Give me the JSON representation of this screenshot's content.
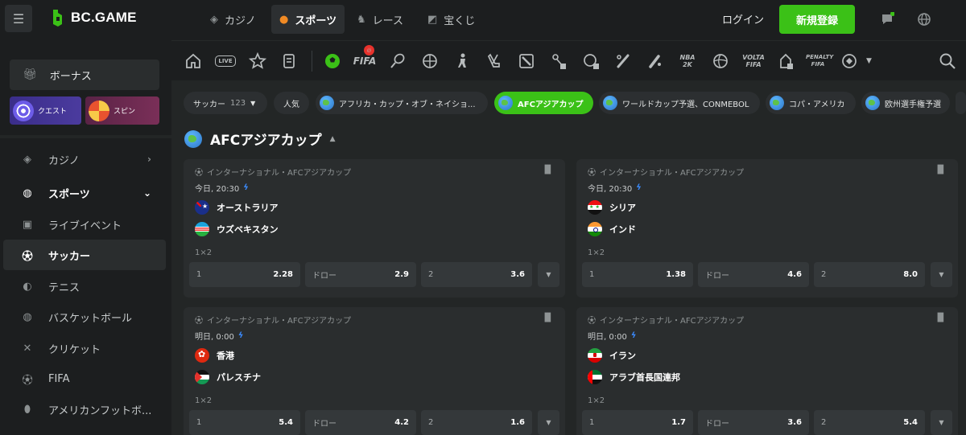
{
  "brand": {
    "name": "BC.GAME"
  },
  "header": {
    "tabs": [
      {
        "label": "カジノ",
        "icon": "casino-icon"
      },
      {
        "label": "スポーツ",
        "icon": "basketball-icon",
        "active": true
      },
      {
        "label": "レース",
        "icon": "horse-icon"
      },
      {
        "label": "宝くじ",
        "icon": "ticket-icon"
      }
    ],
    "login_label": "ログイン",
    "register_label": "新規登録"
  },
  "sidebar": {
    "bonus_label": "ボーナス",
    "quest_label": "クエスト",
    "spin_label": "スピン",
    "items": [
      {
        "label": "カジノ",
        "icon": "casino-icon"
      },
      {
        "label": "スポーツ",
        "icon": "basketball-icon"
      },
      {
        "label": "ライブイベント",
        "icon": "calendar-icon"
      },
      {
        "label": "サッカー",
        "icon": "soccer-ball-icon",
        "active": true
      },
      {
        "label": "テニス",
        "icon": "tennis-ball-icon"
      },
      {
        "label": "バスケットボール",
        "icon": "basketball-icon"
      },
      {
        "label": "クリケット",
        "icon": "cricket-icon"
      },
      {
        "label": "FIFA",
        "icon": "fifa-icon"
      },
      {
        "label": "アメリカンフットボ...",
        "icon": "american-football-icon"
      }
    ]
  },
  "sportbar": {
    "icons": [
      "home-icon",
      "live-icon",
      "star-icon",
      "betslip-icon",
      "soccer-ball-icon",
      "fifa-icon",
      "tennis-icon",
      "basketball-icon",
      "cs-icon",
      "hockey-icon",
      "dota-icon",
      "esports-soccer-icon",
      "golf-icon",
      "baseball-icon",
      "cricket-icon",
      "nba2k-icon",
      "volleyball-icon",
      "volta-fifa-icon",
      "e-hockey-icon",
      "penalty-fifa-icon",
      "more-sports-icon"
    ],
    "small_labels": {
      "live": "LIVE",
      "fifa": "FIFA",
      "nba2k": "NBA 2K",
      "volta": "VOLTA FIFA",
      "penalty": "PENALTY FIFA"
    }
  },
  "filters": {
    "sport": {
      "label": "サッカー",
      "count": "123"
    },
    "chips": [
      {
        "label": "人気",
        "globe": false
      },
      {
        "label": "アフリカ・カップ・オブ・ネイショ...",
        "globe": true
      },
      {
        "label": "AFCアジアカップ",
        "globe": true,
        "active": true
      },
      {
        "label": "ワールドカップ予選、CONMEBOL",
        "globe": true
      },
      {
        "label": "コパ・アメリカ",
        "globe": true
      },
      {
        "label": "欧州選手権予選",
        "globe": true
      }
    ]
  },
  "section": {
    "title": "AFCアジアカップ"
  },
  "matches": [
    {
      "league": "インターナショナル・AFCアジアカップ",
      "time": "今日, 20:30",
      "home": "オーストラリア",
      "home_flag": "f-au",
      "away": "ウズベキスタン",
      "away_flag": "f-uz",
      "market": "1×2",
      "odds": [
        {
          "label": "1",
          "value": "2.28"
        },
        {
          "label": "ドロー",
          "value": "2.9"
        },
        {
          "label": "2",
          "value": "3.6"
        }
      ]
    },
    {
      "league": "インターナショナル・AFCアジアカップ",
      "time": "今日, 20:30",
      "home": "シリア",
      "home_flag": "f-sy",
      "away": "インド",
      "away_flag": "f-in",
      "market": "1×2",
      "odds": [
        {
          "label": "1",
          "value": "1.38"
        },
        {
          "label": "ドロー",
          "value": "4.6"
        },
        {
          "label": "2",
          "value": "8.0"
        }
      ]
    },
    {
      "league": "インターナショナル・AFCアジアカップ",
      "time": "明日, 0:00",
      "home": "香港",
      "home_flag": "f-hk",
      "away": "パレスチナ",
      "away_flag": "f-ps",
      "market": "1×2",
      "odds": [
        {
          "label": "1",
          "value": "5.4"
        },
        {
          "label": "ドロー",
          "value": "4.2"
        },
        {
          "label": "2",
          "value": "1.6"
        }
      ]
    },
    {
      "league": "インターナショナル・AFCアジアカップ",
      "time": "明日, 0:00",
      "home": "イラン",
      "home_flag": "f-ir",
      "away": "アラブ首長国連邦",
      "away_flag": "f-ae",
      "market": "1×2",
      "odds": [
        {
          "label": "1",
          "value": "1.7"
        },
        {
          "label": "ドロー",
          "value": "3.6"
        },
        {
          "label": "2",
          "value": "5.4"
        }
      ]
    }
  ],
  "colors": {
    "accent_green": "#3bc117",
    "bg": "#232626",
    "panel": "#1c1e1f",
    "card": "#2a2d2e",
    "bolt_blue": "#3b8bff"
  }
}
